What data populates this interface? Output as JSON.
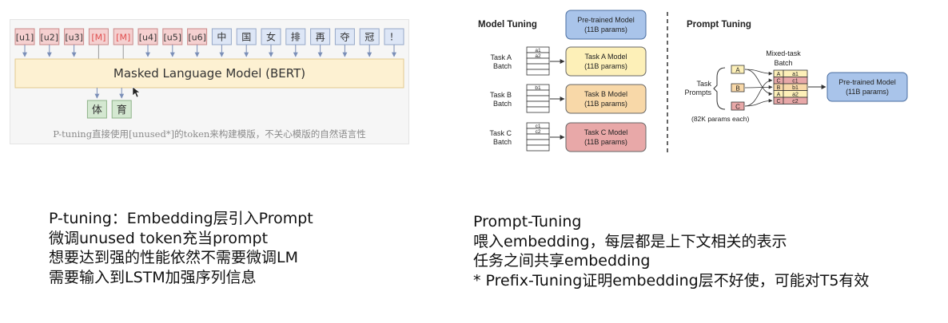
{
  "p_tuning_figure": {
    "tokens": [
      {
        "label": "[u1]",
        "kind": "prompt"
      },
      {
        "label": "[u2]",
        "kind": "prompt"
      },
      {
        "label": "[u3]",
        "kind": "prompt"
      },
      {
        "label": "[M]",
        "kind": "mask"
      },
      {
        "label": "[M]",
        "kind": "mask"
      },
      {
        "label": "[u4]",
        "kind": "prompt"
      },
      {
        "label": "[u5]",
        "kind": "prompt"
      },
      {
        "label": "[u6]",
        "kind": "prompt"
      },
      {
        "label": "中",
        "kind": "text"
      },
      {
        "label": "国",
        "kind": "text"
      },
      {
        "label": "女",
        "kind": "text"
      },
      {
        "label": "排",
        "kind": "text"
      },
      {
        "label": "再",
        "kind": "text"
      },
      {
        "label": "夺",
        "kind": "text"
      },
      {
        "label": "冠",
        "kind": "text"
      },
      {
        "label": "！",
        "kind": "text"
      }
    ],
    "model_label": "Masked Language Model (BERT)",
    "outputs": [
      "体",
      "育"
    ],
    "caption": "P-tuning直接使用[unused*]的token来构建模版，不关心模版的自然语言性",
    "colors": {
      "prompt_fill": "#f5d0d0",
      "prompt_stroke": "#c98a8a",
      "mask_text": "#e05050",
      "text_fill": "#dde6f6",
      "text_stroke": "#97a8c8",
      "model_fill": "#fdf1d2",
      "model_stroke": "#e2c98e",
      "output_fill": "#d4e8d1",
      "output_stroke": "#8fb38a",
      "arrow": "#7b8fb8"
    }
  },
  "prompt_tuning_figure": {
    "model_tuning": {
      "title": "Model Tuning",
      "pretrained_model": {
        "title": "Pre-trained Model",
        "params": "(11B params)"
      },
      "tasks": [
        {
          "batch_label": [
            "Task A",
            "Batch"
          ],
          "entries": [
            "a1",
            "a2"
          ],
          "model": "Task A Model",
          "params": "(11B params)",
          "color": "#fdf0b8"
        },
        {
          "batch_label": [
            "Task B",
            "Batch"
          ],
          "entries": [
            "b1"
          ],
          "model": "Task B Model",
          "params": "(11B params)",
          "color": "#f8d8a8"
        },
        {
          "batch_label": [
            "Task C",
            "Batch"
          ],
          "entries": [
            "c1",
            "c2"
          ],
          "model": "Task C Model",
          "params": "(11B params)",
          "color": "#e8a8a8"
        }
      ]
    },
    "prompt_tuning": {
      "title": "Prompt Tuning",
      "task_prompts_label": [
        "Task",
        "Prompts"
      ],
      "prompt_tags": [
        "A",
        "B",
        "C"
      ],
      "params_note": "(82K params each)",
      "mixed_batch_label": [
        "Mixed-task",
        "Batch"
      ],
      "mixed_batch_rows": [
        {
          "prompt": "A",
          "item": "a1"
        },
        {
          "prompt": "C",
          "item": "c1"
        },
        {
          "prompt": "B",
          "item": "b1"
        },
        {
          "prompt": "A",
          "item": "a2"
        },
        {
          "prompt": "C",
          "item": "c2"
        }
      ],
      "pretrained_model": {
        "title": "Pre-trained Model",
        "params": "(11B params)"
      }
    },
    "colors": {
      "pretrained_fill": "#a9c4ea",
      "pretrained_stroke": "#4a6ea0",
      "A": "#fdf0b8",
      "B": "#f8d8a8",
      "C": "#e8a8a8"
    }
  },
  "notes_left": [
    "P-tuning：Embedding层引入Prompt",
    "微调unused token充当prompt",
    "想要达到强的性能依然不需要微调LM",
    "需要输入到LSTM加强序列信息"
  ],
  "notes_right": [
    "Prompt-Tuning",
    "喂入embedding，每层都是上下文相关的表示",
    "任务之间共享embedding",
    "* Prefix-Tuning证明embedding层不好使，可能对T5有效"
  ]
}
